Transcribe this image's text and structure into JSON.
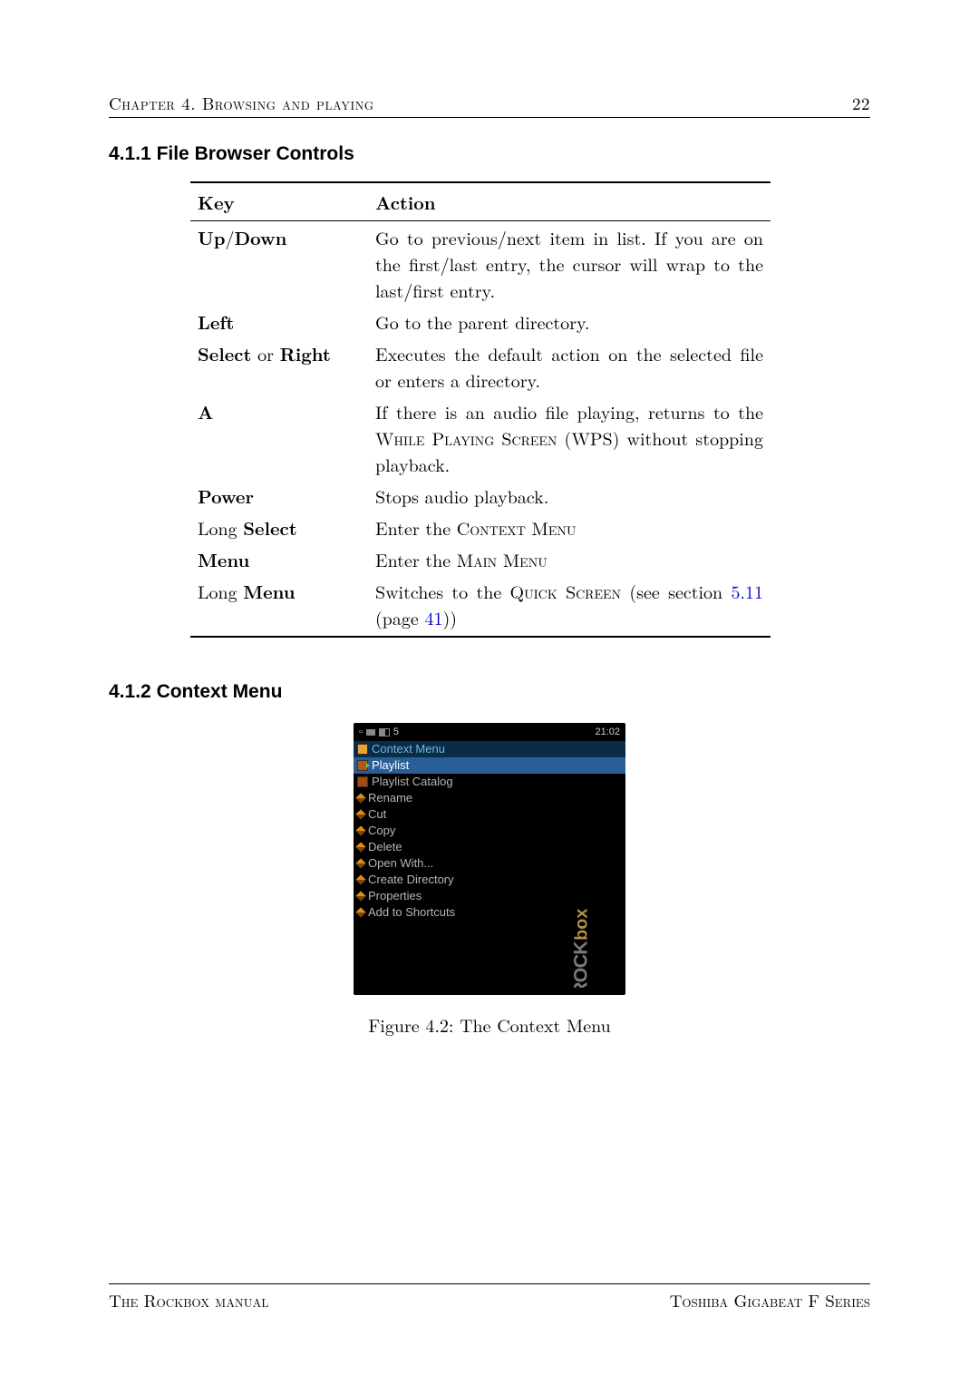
{
  "header": {
    "left": "Chapter 4.   Browsing and playing",
    "pageno": "22"
  },
  "section1": {
    "number": "4.1.1",
    "title": "File Browser Controls"
  },
  "table": {
    "head_key": "Key",
    "head_action": "Action",
    "rows": [
      {
        "key_html": "<b>Up</b>/<b>Down</b>",
        "action_html": "Go to previous/next item in list. If you are on the first/last entry, the cursor will wrap to the last/first entry."
      },
      {
        "key_html": "<b>Left</b>",
        "action_html": "Go to the parent directory."
      },
      {
        "key_html": "<b>Select</b> or <b>Right</b>",
        "action_html": "Executes the default action on the selected file or enters a directory."
      },
      {
        "key_html": "<b>A</b>",
        "action_html": "If there is an audio file playing, returns to the <span class=\"sc\">While Playing Screen</span> (WPS) without stopping playback."
      },
      {
        "key_html": "<b>Power</b>",
        "action_html": "Stops audio playback."
      },
      {
        "key_html": "Long <b>Select</b>",
        "action_html": "Enter the <span class=\"sc\">Context Menu</span>"
      },
      {
        "key_html": "<b>Menu</b>",
        "action_html": "Enter the <span class=\"sc\">Main Menu</span>"
      },
      {
        "key_html": "Long <b>Menu</b>",
        "action_html": "Switches to the <span class=\"sc\">Quick Screen</span> (see section <span class=\"link\">5.11</span> (page <span class=\"link\">41</span>))"
      }
    ]
  },
  "section2": {
    "number": "4.1.2",
    "title": "Context Menu"
  },
  "screenshot": {
    "status_left_icon": "▯",
    "status_batt": "5",
    "clock": "21:02",
    "title": "Context Menu",
    "items": [
      {
        "label": "Playlist",
        "icon": "playlist",
        "highlight": true
      },
      {
        "label": "Playlist Catalog",
        "icon": "catalog"
      },
      {
        "label": "Rename",
        "icon": "diamond"
      },
      {
        "label": "Cut",
        "icon": "diamond"
      },
      {
        "label": "Copy",
        "icon": "diamond"
      },
      {
        "label": "Delete",
        "icon": "diamond"
      },
      {
        "label": "Open With...",
        "icon": "diamond"
      },
      {
        "label": "Create Directory",
        "icon": "diamond"
      },
      {
        "label": "Properties",
        "icon": "diamond"
      },
      {
        "label": "Add to Shortcuts",
        "icon": "diamond"
      }
    ],
    "logo_text": "ROCKbox"
  },
  "figure_caption": "Figure 4.2: The Context Menu",
  "footer": {
    "left": "The Rockbox manual",
    "right": "Toshiba Gigabeat F Series"
  }
}
